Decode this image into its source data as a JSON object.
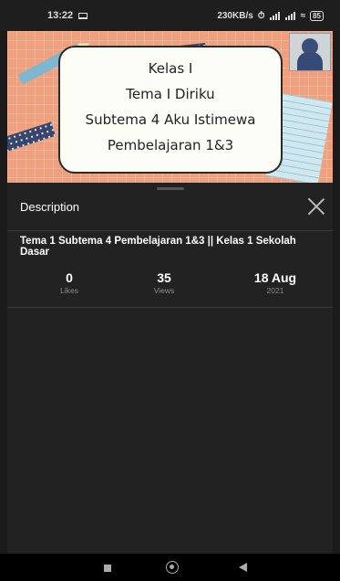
{
  "status_bar": {
    "time": "13:22",
    "network_speed": "230KB/s",
    "battery": "85"
  },
  "video": {
    "lines": [
      "Kelas I",
      "Tema I Diriku",
      "Subtema 4 Aku Istimewa",
      "Pembelajaran 1&3"
    ]
  },
  "description": {
    "header": "Description",
    "title": "Tema 1 Subtema 4 Pembelajaran 1&3 || Kelas 1 Sekolah Dasar",
    "stats": [
      {
        "value": "0",
        "label": "Likes"
      },
      {
        "value": "35",
        "label": "Views"
      },
      {
        "value": "18 Aug",
        "label": "2021"
      }
    ]
  },
  "icons": {
    "close": "close-icon",
    "nav_recents": "square-icon",
    "nav_home": "circle-icon",
    "nav_back": "triangle-back-icon"
  }
}
